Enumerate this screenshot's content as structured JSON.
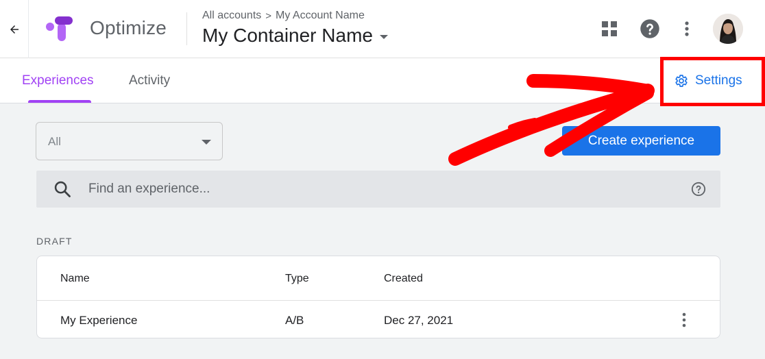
{
  "header": {
    "product_name": "Optimize",
    "breadcrumb": {
      "all_accounts": "All accounts",
      "separator": ">",
      "account_name": "My Account Name"
    },
    "container_name": "My Container Name",
    "icons": [
      "arrow-back-icon",
      "optimize-logo-icon",
      "apps-grid-icon",
      "help-icon",
      "more-vert-icon",
      "user-avatar"
    ]
  },
  "tabs": [
    {
      "label": "Experiences",
      "active": true
    },
    {
      "label": "Activity",
      "active": false
    }
  ],
  "settings": {
    "label": "Settings",
    "icon": "gear-icon"
  },
  "filter": {
    "selected": "All"
  },
  "create_button": {
    "label": "Create experience"
  },
  "search": {
    "placeholder": "Find an experience...",
    "icon": "search-icon",
    "help_icon": "help-outline-icon"
  },
  "draft": {
    "label": "DRAFT",
    "columns": [
      "Name",
      "Type",
      "Created"
    ],
    "rows": [
      {
        "name": "My Experience",
        "type": "A/B",
        "created": "Dec 27, 2021"
      }
    ]
  },
  "colors": {
    "accent_purple": "#a142f4",
    "primary_blue": "#1a73e8",
    "highlight_red": "#ff0000",
    "page_background": "#f1f3f4"
  }
}
